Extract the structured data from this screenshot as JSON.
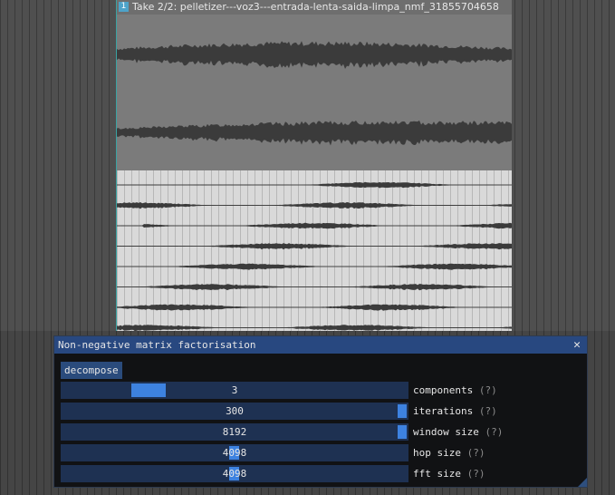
{
  "take": {
    "index_badge": "1",
    "label": "Take 2/2: pelletizer---voz3---entrada-lenta-saida-limpa_nmf_31855704658"
  },
  "dialog": {
    "title": "Non-negative matrix factorisation",
    "close_glyph": "✕",
    "decompose_label": "decompose",
    "help_marker": "(?)",
    "sliders": [
      {
        "value": "3",
        "label": "components",
        "level": 0.23
      },
      {
        "value": "300",
        "label": "iterations",
        "level": 1.0
      },
      {
        "value": "8192",
        "label": "window size",
        "level": 1.0
      },
      {
        "value": "4098",
        "label": "hop size",
        "level": 0.5
      },
      {
        "value": "4098",
        "label": "fft size",
        "level": 0.5
      }
    ]
  },
  "colors": {
    "title_bar": "#284880",
    "slider_track": "#1e3152",
    "slider_grab": "#3d82e0",
    "waveform": "#3b3b3b",
    "take_outline": "#3aa3a3"
  }
}
